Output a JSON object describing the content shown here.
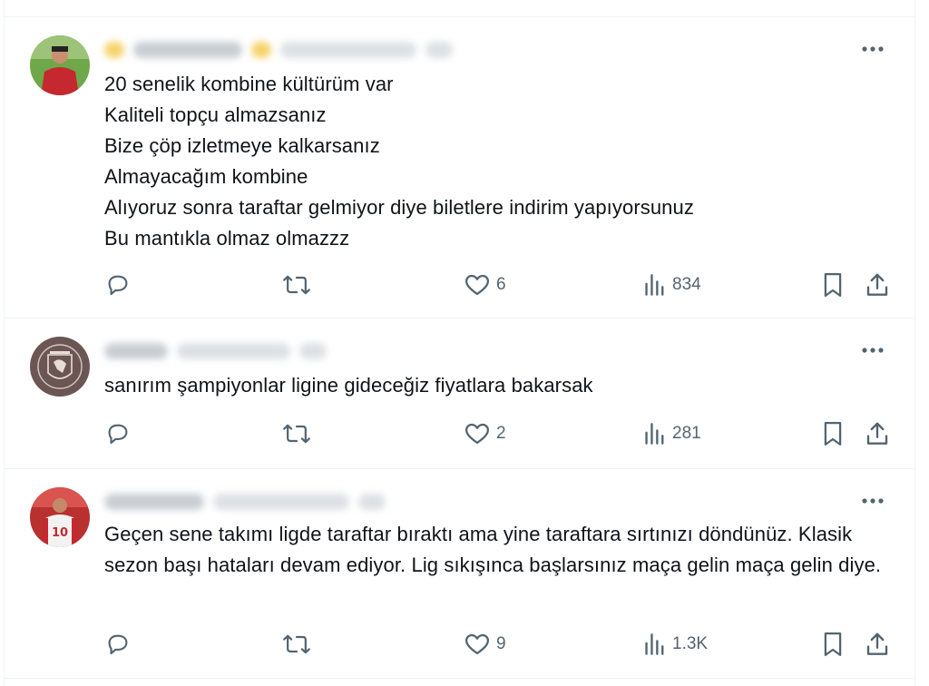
{
  "tweets": [
    {
      "text": "20 senelik kombine kültürüm var\nKaliteli topçu almazsanız\nBize çöp izletmeye kalkarsanız\nAlmayacağım kombine\nAlıyoruz sonra taraftar gelmiyor diye biletlere indirim yapıyorsunuz\nBu mantıkla olmaz olmazzz",
      "likes": "6",
      "views": "834"
    },
    {
      "text": "sanırım şampiyonlar ligine gideceğiz fiyatlara bakarsak",
      "likes": "2",
      "views": "281"
    },
    {
      "text": "Geçen sene takımı ligde taraftar bıraktı ama yine taraftara sırtınızı döndünüz. Klasik sezon başı hataları devam ediyor. Lig sıkışınca başlarsınız maça gelin maça gelin diye.",
      "likes": "9",
      "views": "1.3K"
    }
  ],
  "icons": {
    "reply": "reply-icon",
    "retweet": "retweet-icon",
    "like": "heart-icon",
    "views": "views-icon",
    "bookmark": "bookmark-icon",
    "share": "share-icon",
    "more": "more-icon"
  },
  "colors": {
    "text": "#0f1419",
    "secondary": "#536471",
    "border": "#eff3f4"
  }
}
